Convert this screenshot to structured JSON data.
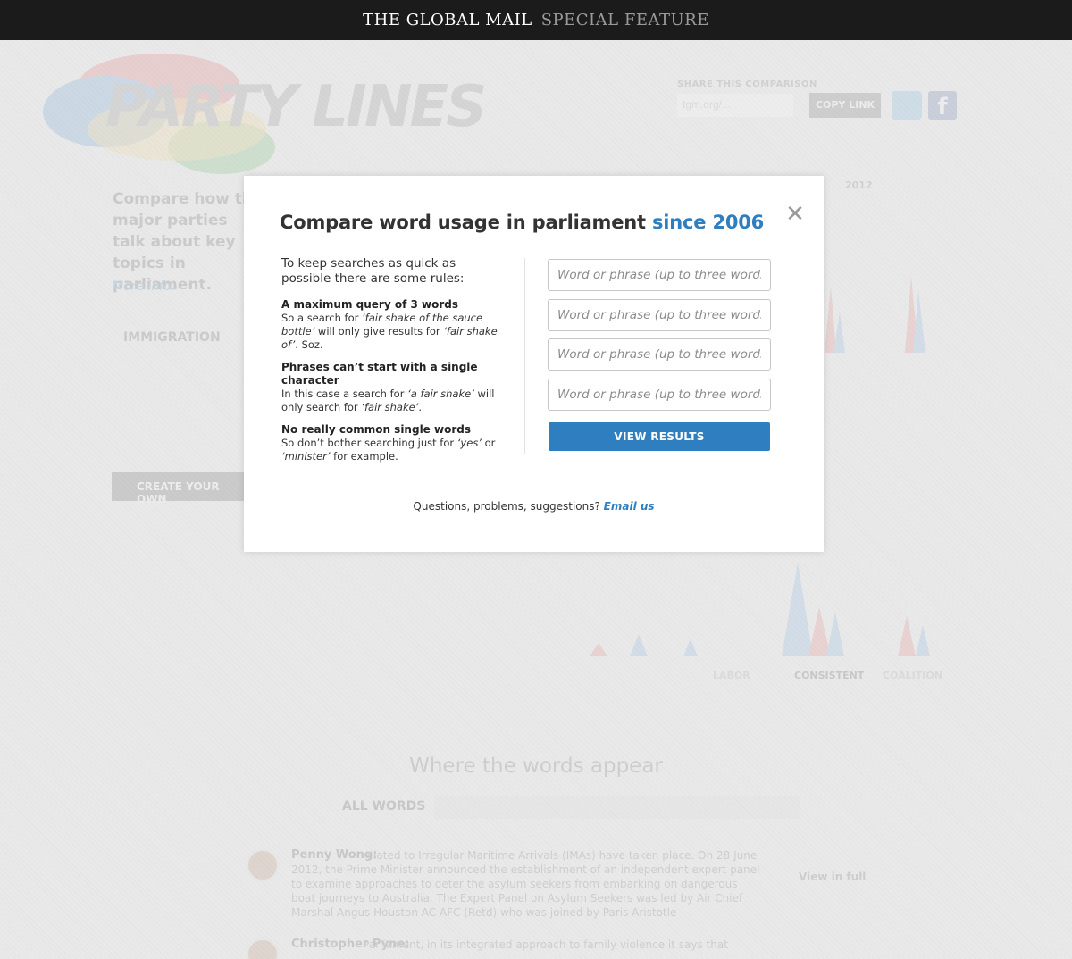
{
  "topbar": {
    "brand": "THE GLOBAL MAIL",
    "feature": "SPECIAL FEATURE"
  },
  "background": {
    "logo": "PARTY LINES",
    "share_label": "SHARE THIS COMPARISON",
    "share_url": "tgm.org/...",
    "copy_link": "COPY LINK",
    "intro": "Compare how the major parties talk about key topics in parliament.",
    "more_info": "More info.",
    "topic": "IMMIGRATION",
    "create_button": "CREATE YOUR OWN",
    "year": "2012",
    "legend": [
      "LABOR",
      "CONSISTENT",
      "COALITION"
    ],
    "where_title": "Where the words appear",
    "all_words": "ALL WORDS",
    "view_full": "View in full",
    "speeches": [
      {
        "speaker": "Penny Wong:",
        "text": "related to Irregular Maritime Arrivals (IMAs) have taken place. On 28 June 2012, the Prime Minister announced the establishment of an independent expert panel to examine approaches to deter the asylum seekers from embarking on dangerous boat journeys to Australia. The Expert Panel on Asylum Seekers was led by Air Chief Marshal Angus Houston AC AFC (Retd) who was joined by Paris Aristotle"
      },
      {
        "speaker": "Christopher Pyne:",
        "text": "Parliament, in its integrated approach to family violence it says that"
      }
    ]
  },
  "modal": {
    "title_main": "Compare word usage in parliament",
    "title_accent": "since 2006",
    "close_symbol": "✕",
    "intro": "To keep searches as quick as possible there are some rules:",
    "rules": [
      {
        "heading": "A maximum query of 3 words",
        "body_1": "So a search for ",
        "example_1": "‘fair shake of the sauce bottle’",
        "body_2": " will only give results for ",
        "example_2": "‘fair shake of’",
        "body_3": ". Soz."
      },
      {
        "heading": "Phrases can’t start with a single character",
        "body_1": "In this case a search for ",
        "example_1": "‘a fair shake’",
        "body_2": " will only search for ",
        "example_2": "‘fair shake’",
        "body_3": "."
      },
      {
        "heading": "No really common single words",
        "body_1": "So don’t bother searching just for ",
        "example_1": "‘yes’",
        "body_2": " or ",
        "example_2": "‘minister’",
        "body_3": " for example."
      }
    ],
    "field_placeholder": "Word or phrase (up to three words)",
    "fields": [
      "",
      "",
      "",
      ""
    ],
    "view_button": "VIEW RESULTS",
    "footer_text": "Questions, problems, suggestions?",
    "footer_link": "Email us"
  }
}
